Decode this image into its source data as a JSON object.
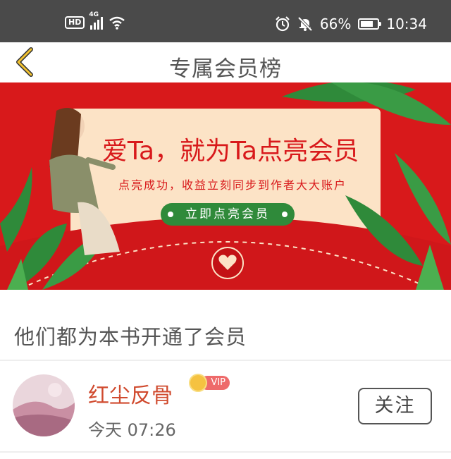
{
  "status_bar": {
    "hd": "HD",
    "network": "4G",
    "battery": "66%",
    "time": "10:34",
    "icons": [
      "hd-icon",
      "signal-icon",
      "wifi-icon",
      "alarm-icon",
      "mute-icon",
      "battery-icon"
    ]
  },
  "header": {
    "back_icon": "chevron-left-icon",
    "title": "专属会员榜"
  },
  "banner": {
    "headline": "爱Ta，就为Ta点亮会员",
    "subtitle": "点亮成功，收益立刻同步到作者大大账户",
    "button_label": "立即点亮会员",
    "colors": {
      "background": "#d8191b",
      "card": "#fce3c6",
      "button": "#2f8a3a"
    }
  },
  "section": {
    "title": "他们都为本书开通了会员"
  },
  "members": [
    {
      "name": "红尘反骨",
      "badge": "VIP",
      "time": "今天 07:26",
      "follow_label": "关注"
    }
  ]
}
